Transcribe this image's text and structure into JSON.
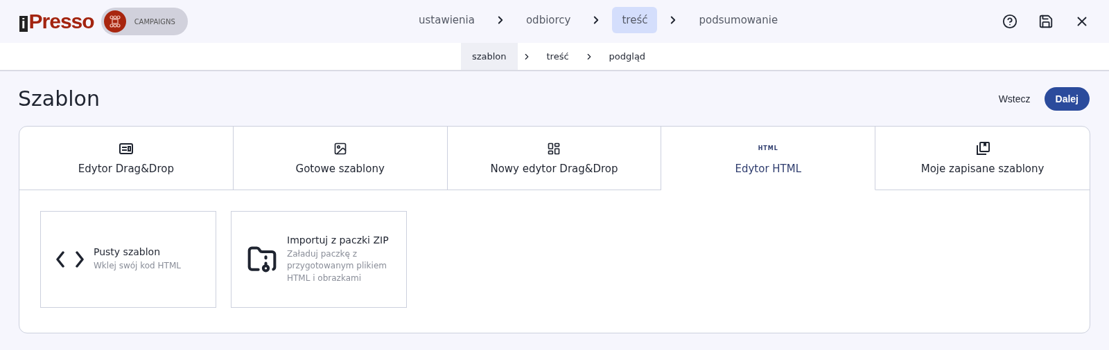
{
  "logo": {
    "mark": "i",
    "name": "Presso",
    "badge": "CAMPAIGNS"
  },
  "steps": [
    {
      "label": "ustawienia",
      "selected": false
    },
    {
      "label": "odbiorcy",
      "selected": false
    },
    {
      "label": "treść",
      "selected": true
    },
    {
      "label": "podsumowanie",
      "selected": false
    }
  ],
  "substeps": [
    {
      "label": "szablon",
      "selected": true
    },
    {
      "label": "treść",
      "selected": false
    },
    {
      "label": "podgląd",
      "selected": false
    }
  ],
  "title": "Szablon",
  "buttons": {
    "back": "Wstecz",
    "next": "Dalej"
  },
  "tabs": [
    {
      "kind": "layout",
      "label": "Edytor Drag&Drop",
      "selected": false
    },
    {
      "kind": "image",
      "label": "Gotowe szablony",
      "selected": false
    },
    {
      "kind": "dashboard",
      "label": "Nowy edytor Drag&Drop",
      "selected": false
    },
    {
      "kind": "html",
      "icon_text": "HTML",
      "label": "Edytor HTML",
      "selected": true
    },
    {
      "kind": "library",
      "label": "Moje zapisane szablony",
      "selected": false
    }
  ],
  "options": [
    {
      "kind": "code",
      "title": "Pusty szablon",
      "description": "Wklej swój kod HTML"
    },
    {
      "kind": "zip",
      "title": "Importuj z paczki ZIP",
      "description": "Załaduj paczkę z przygotowanym plikiem HTML i obrazkami"
    }
  ]
}
